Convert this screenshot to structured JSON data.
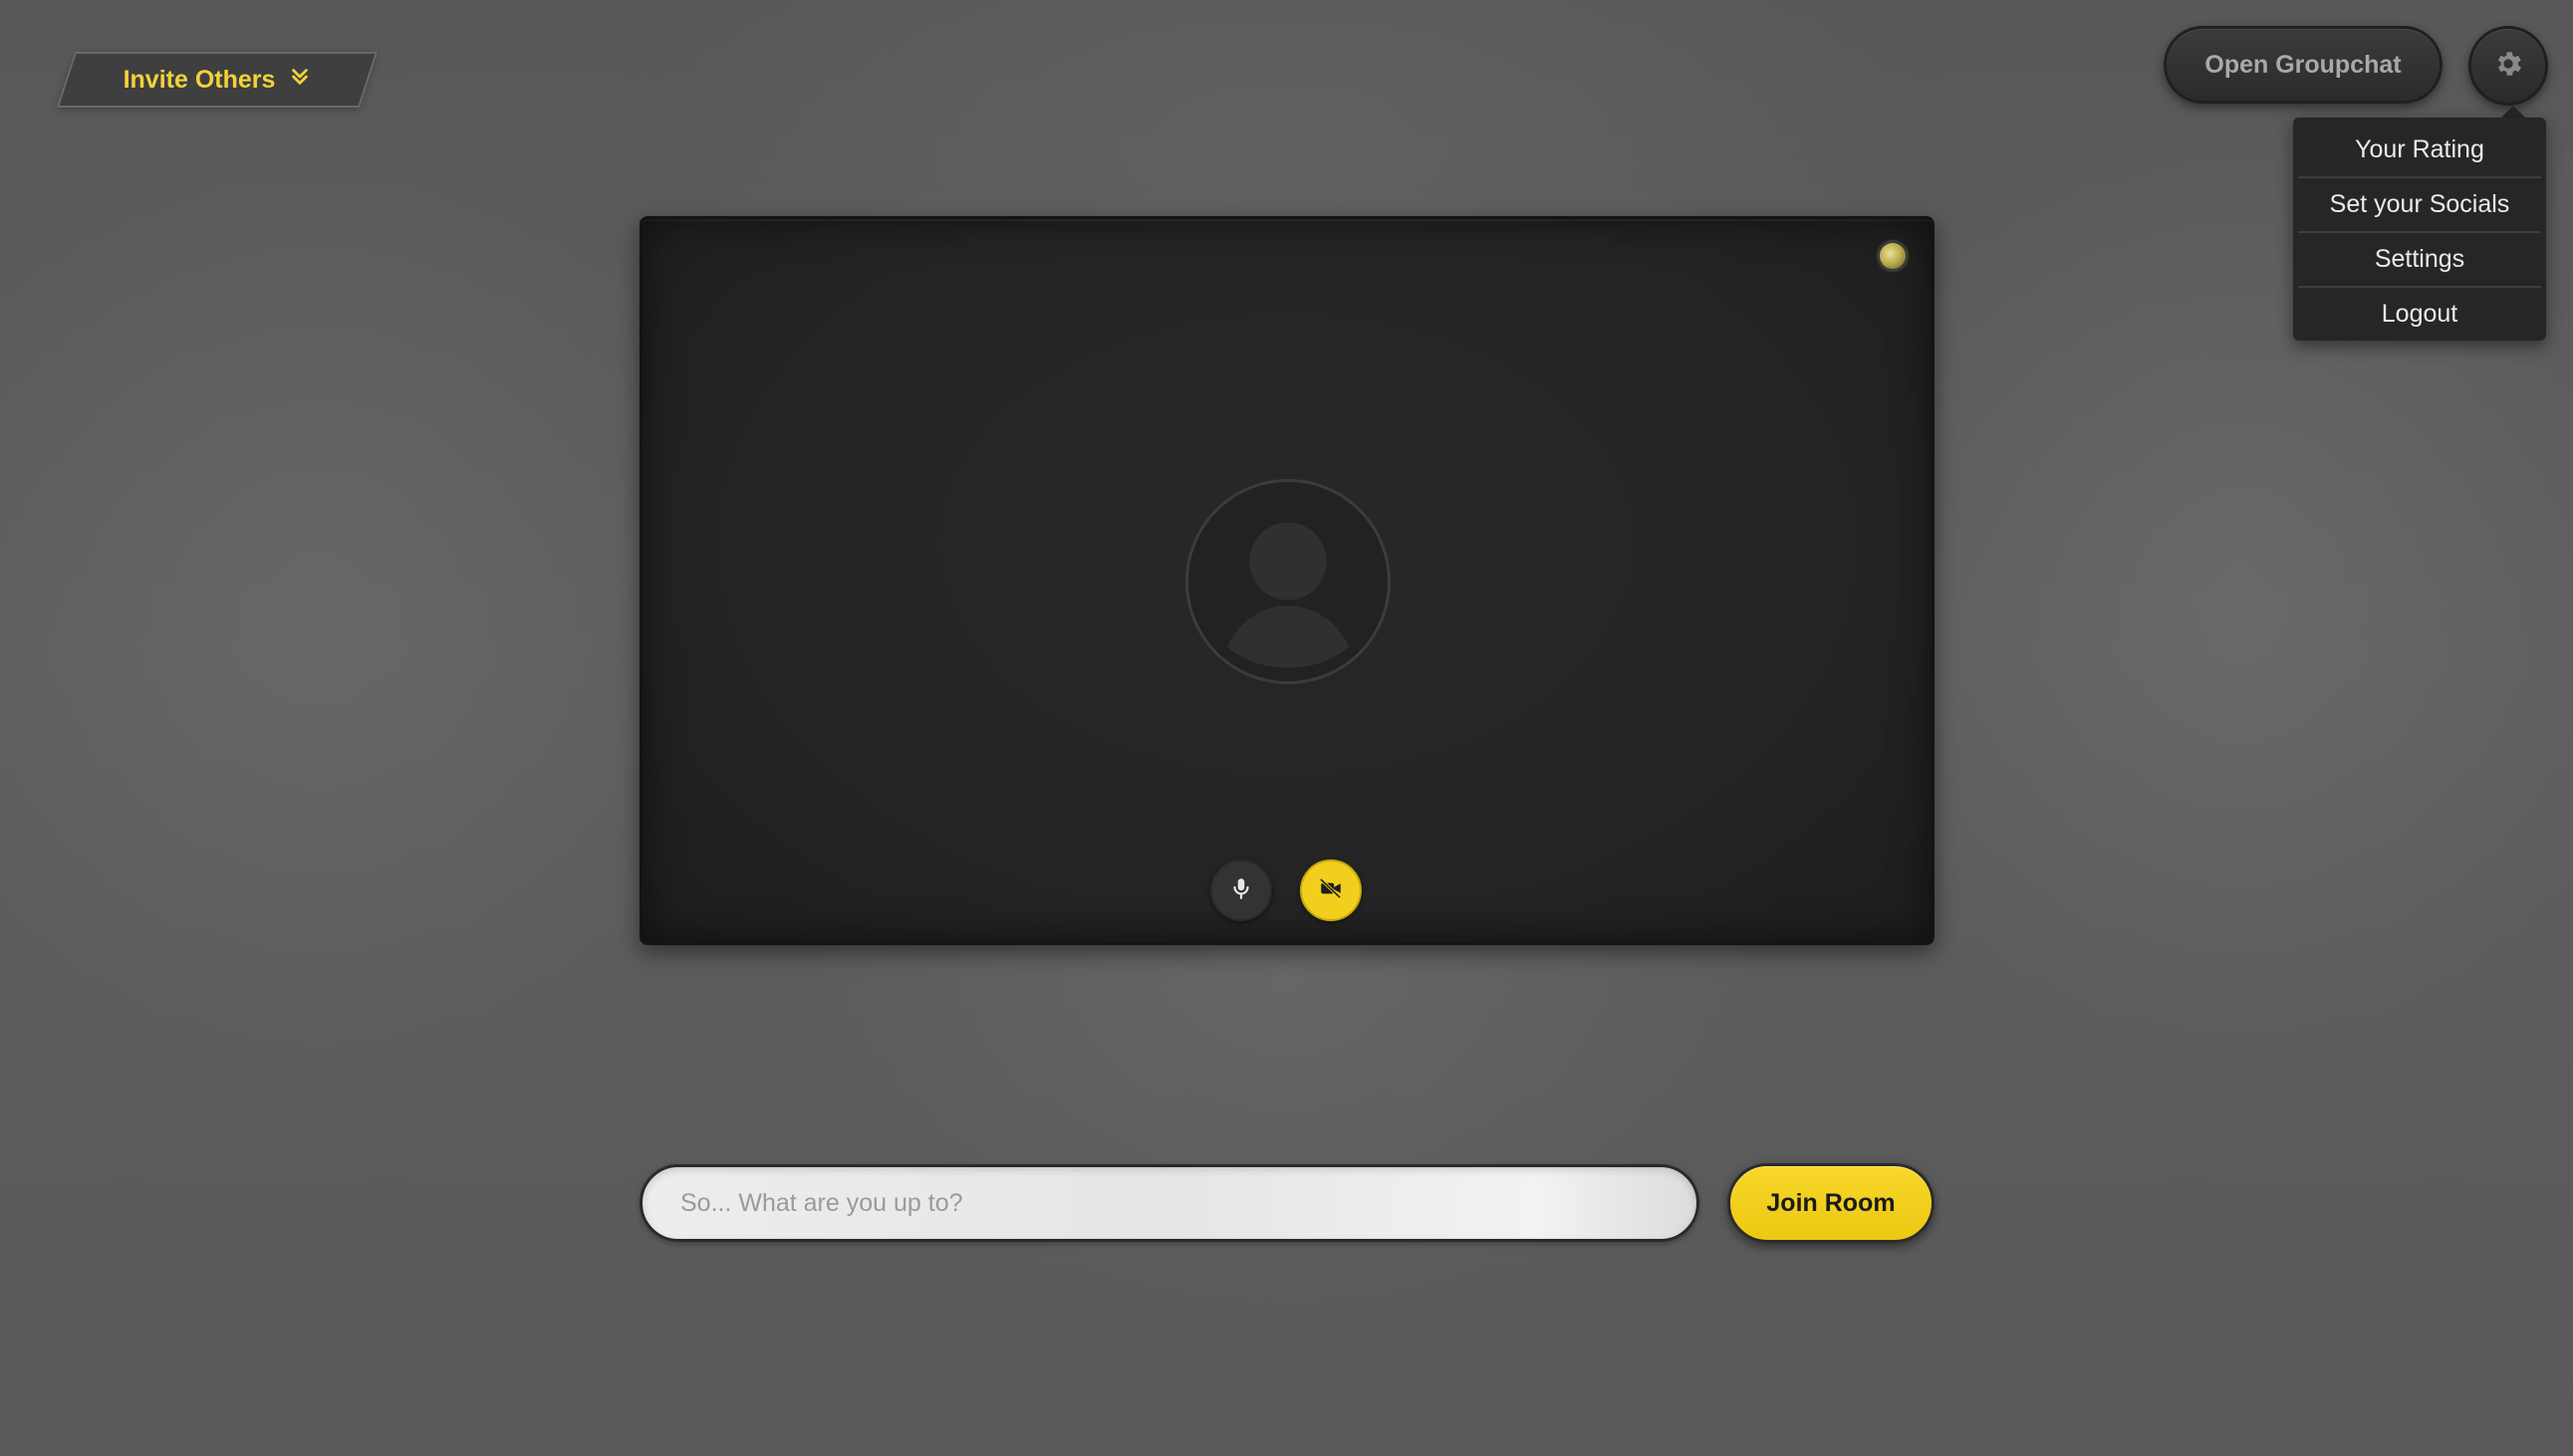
{
  "header": {
    "invite_label": "Invite Others",
    "groupchat_label": "Open Groupchat"
  },
  "settings_menu": {
    "items": [
      {
        "label": "Your Rating"
      },
      {
        "label": "Set your Socials"
      },
      {
        "label": "Settings"
      },
      {
        "label": "Logout"
      }
    ]
  },
  "video": {
    "mic_icon": "microphone-icon",
    "camera_icon": "camera-off-icon",
    "camera_off_color": "#f1cf1c"
  },
  "join": {
    "status_placeholder": "So... What are you up to?",
    "status_value": "",
    "join_label": "Join Room"
  },
  "colors": {
    "accent": "#f1cf1c",
    "background": "#5b5b5b",
    "panel": "#262626"
  }
}
